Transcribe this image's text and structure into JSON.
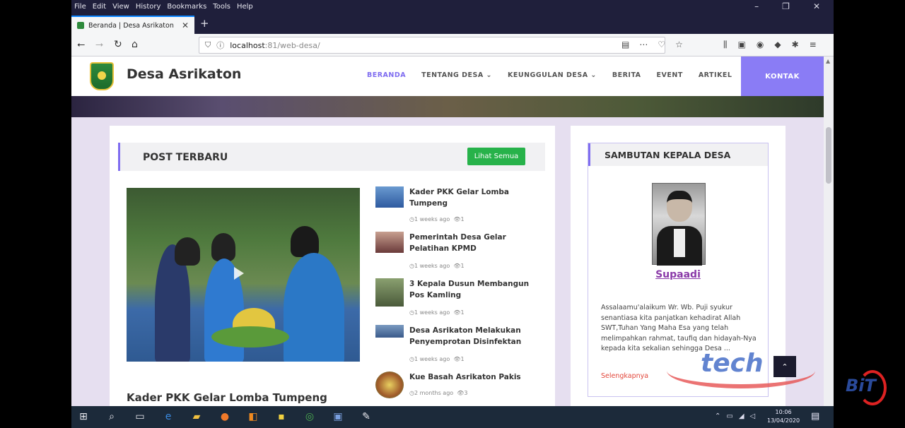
{
  "browser": {
    "menu": [
      "File",
      "Edit",
      "View",
      "History",
      "Bookmarks",
      "Tools",
      "Help"
    ],
    "tab_title": "Beranda | Desa Asrikaton",
    "url_host": "localhost",
    "url_path": ":81/web-desa/"
  },
  "site": {
    "name": "Desa Asrikaton",
    "nav": [
      {
        "label": "BERANDA"
      },
      {
        "label": "TENTANG DESA"
      },
      {
        "label": "KEUNGGULAN DESA"
      },
      {
        "label": "BERITA"
      },
      {
        "label": "EVENT"
      },
      {
        "label": "ARTIKEL"
      }
    ],
    "kontak": "KONTAK"
  },
  "posts": {
    "heading": "POST TERBARU",
    "see_all": "Lihat Semua",
    "main_title": "Kader PKK Gelar Lomba Tumpeng",
    "items": [
      {
        "title": "Kader PKK Gelar Lomba Tumpeng",
        "time": "1 weeks ago",
        "views": "1"
      },
      {
        "title": "Pemerintah Desa Gelar Pelatihan KPMD",
        "time": "1 weeks ago",
        "views": "1"
      },
      {
        "title": "3 Kepala Dusun Membangun Pos Kamling",
        "time": "1 weeks ago",
        "views": "1"
      },
      {
        "title": "Desa Asrikaton Melakukan Penyemprotan Disinfektan",
        "time": "1 weeks ago",
        "views": "1"
      },
      {
        "title": "Kue Basah Asrikaton Pakis",
        "time": "2 months ago",
        "views": "3"
      }
    ]
  },
  "sambutan": {
    "heading": "SAMBUTAN KEPALA DESA",
    "name": "Supaadi",
    "text": "Assalaamu'alaikum Wr. Wb. Puji syukur senantiasa kita panjatkan kehadirat Allah SWT,Tuhan Yang Maha Esa yang telah melimpahkan rahmat, taufiq dan hidayah-Nya kepada kita sekalian sehingga Desa ...",
    "more": "Selengkapnya"
  },
  "watermark": "tech",
  "taskbar": {
    "time": "10:06",
    "date": "13/04/2020"
  },
  "channel_logo": "BiT"
}
